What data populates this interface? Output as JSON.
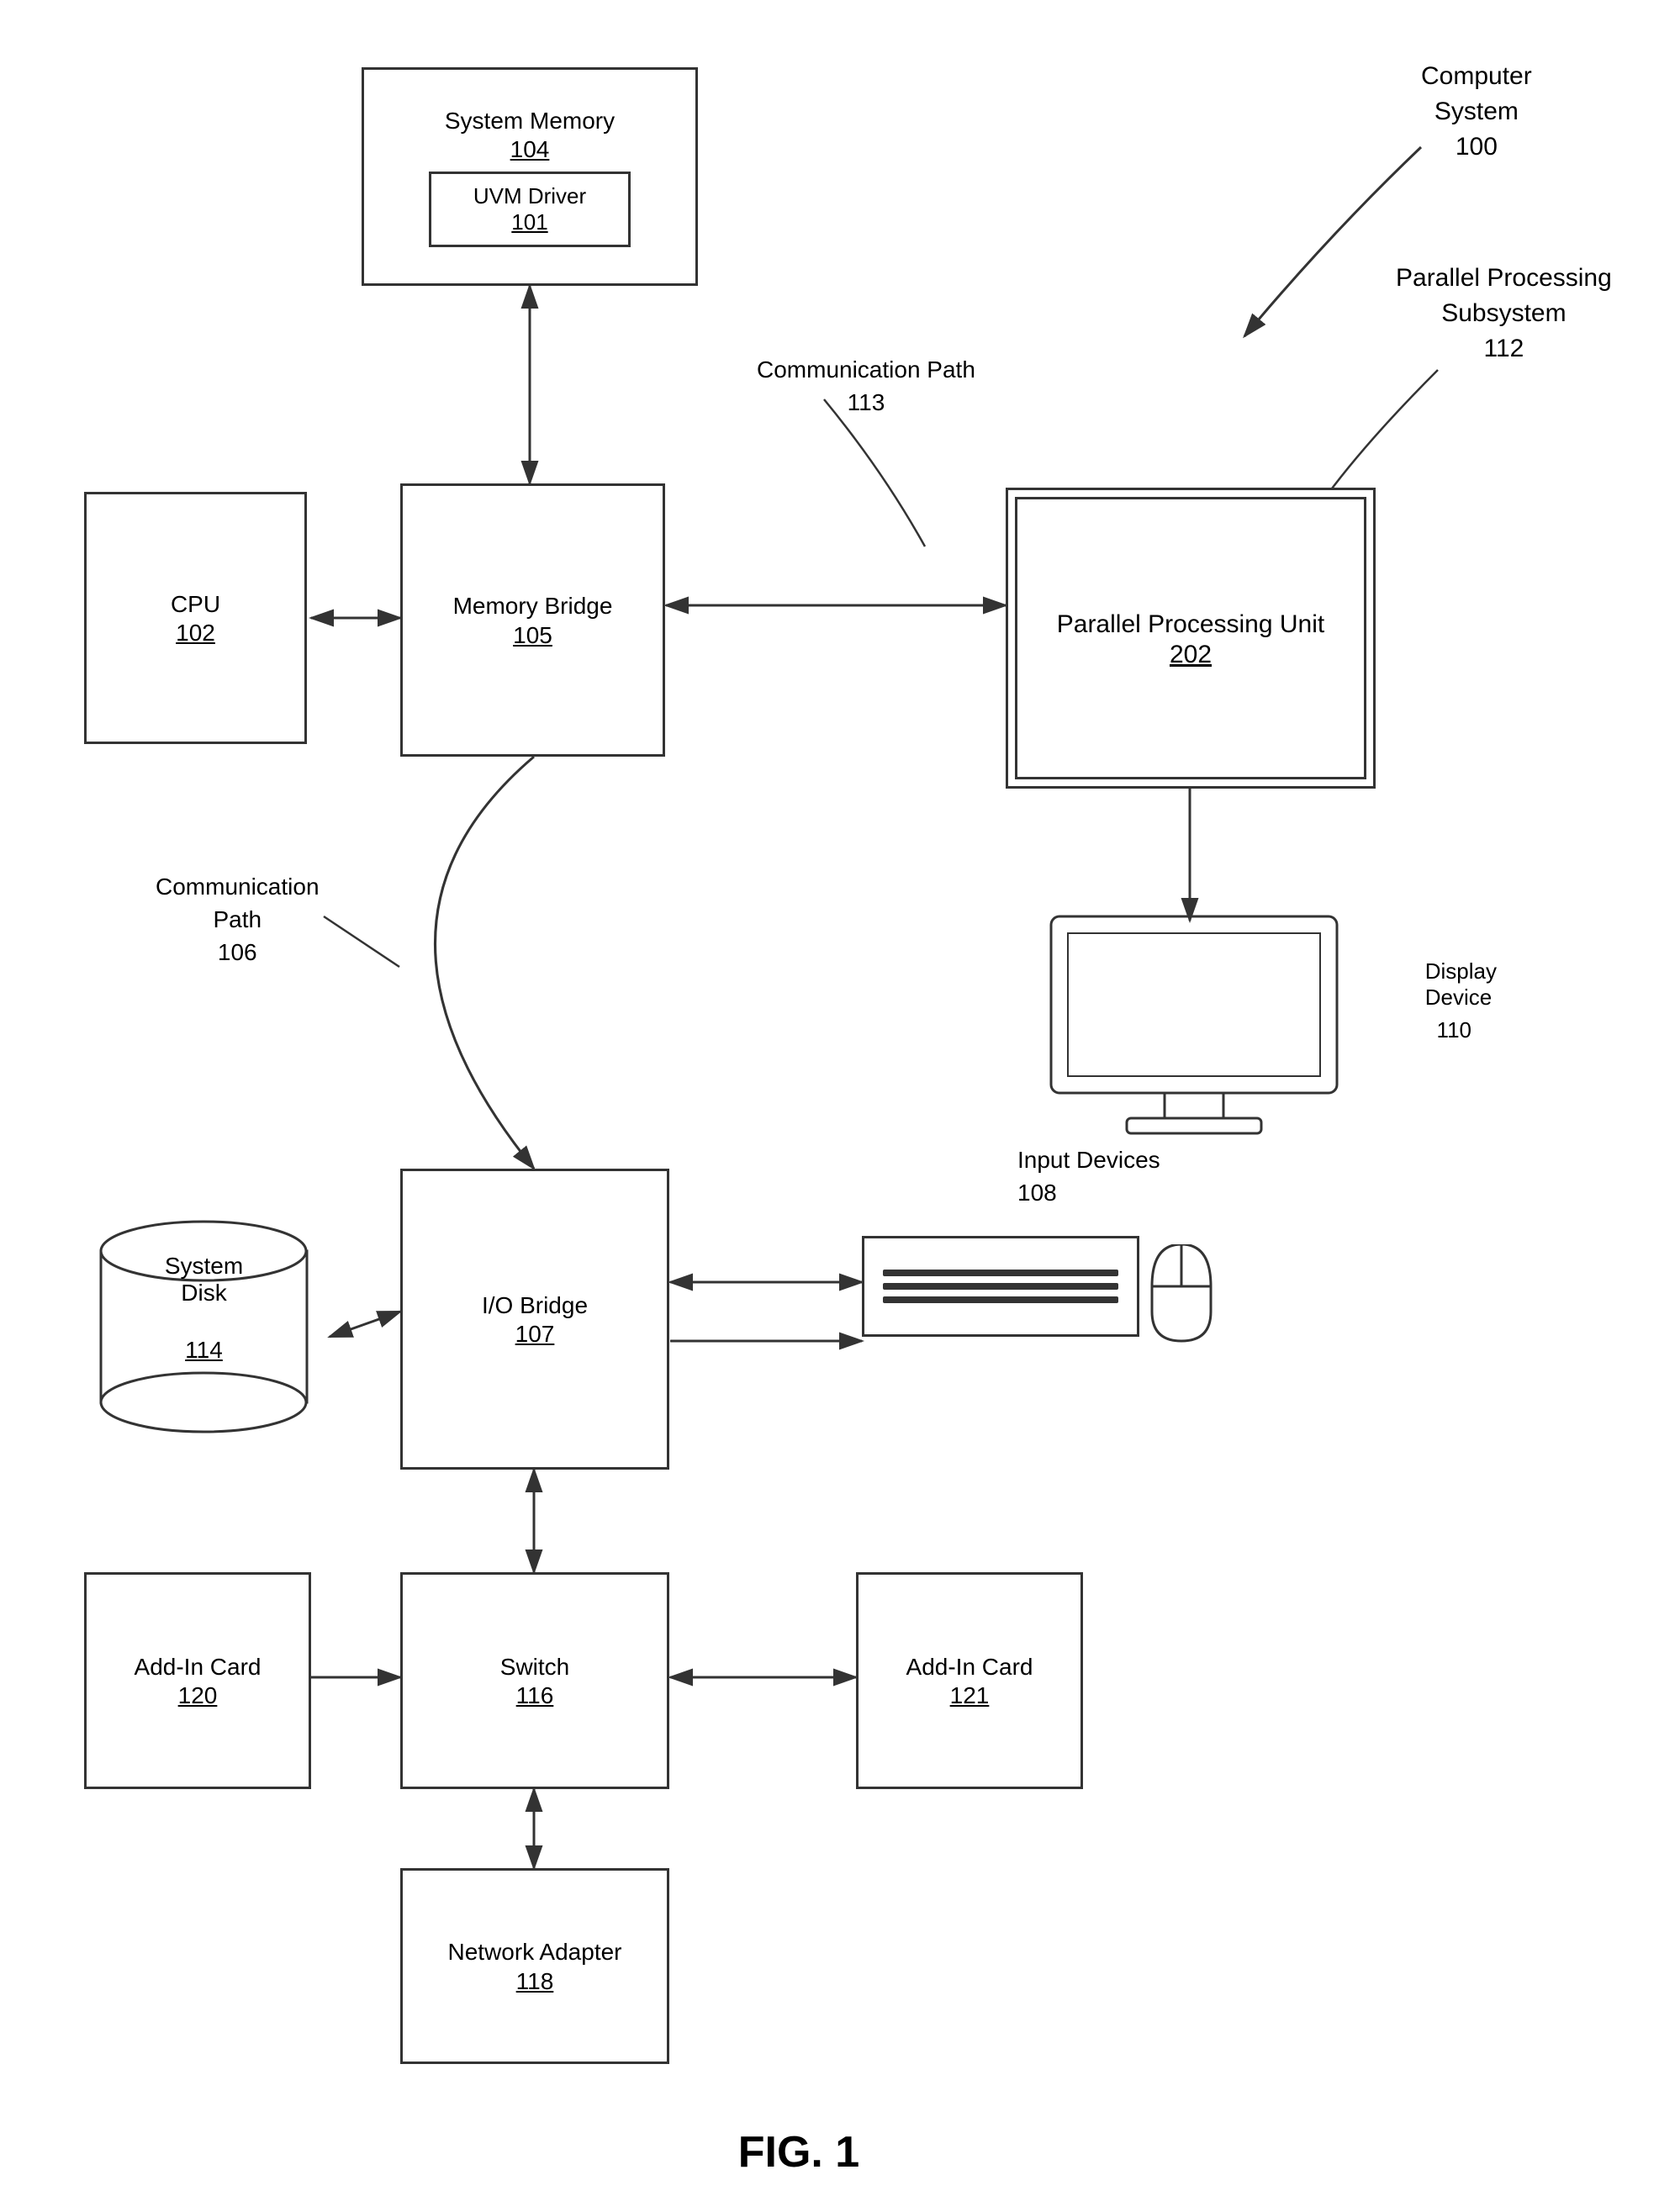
{
  "title": "FIG. 1",
  "components": {
    "system_memory": {
      "label": "System Memory",
      "num": "104"
    },
    "uvm_driver": {
      "label": "UVM Driver",
      "num": "101"
    },
    "cpu": {
      "label": "CPU",
      "num": "102"
    },
    "memory_bridge": {
      "label": "Memory Bridge",
      "num": "105"
    },
    "parallel_processing_unit": {
      "label": "Parallel Processing Unit",
      "num": "202"
    },
    "io_bridge": {
      "label": "I/O Bridge",
      "num": "107"
    },
    "switch": {
      "label": "Switch",
      "num": "116"
    },
    "network_adapter": {
      "label": "Network Adapter",
      "num": "118"
    },
    "add_in_card_120": {
      "label": "Add-In Card",
      "num": "120"
    },
    "add_in_card_121": {
      "label": "Add-In Card",
      "num": "121"
    },
    "system_disk": {
      "label": "System Disk",
      "num": "114"
    }
  },
  "labels": {
    "computer_system": "Computer System\n100",
    "parallel_processing_subsystem": "Parallel Processing\nSubsystem\n112",
    "communication_path_113": "Communication Path\n113",
    "communication_path_106": "Communication\nPath\n106",
    "display_device": "Display\nDevice\n110",
    "input_devices": "Input Devices\n108",
    "fig": "FIG. 1"
  }
}
